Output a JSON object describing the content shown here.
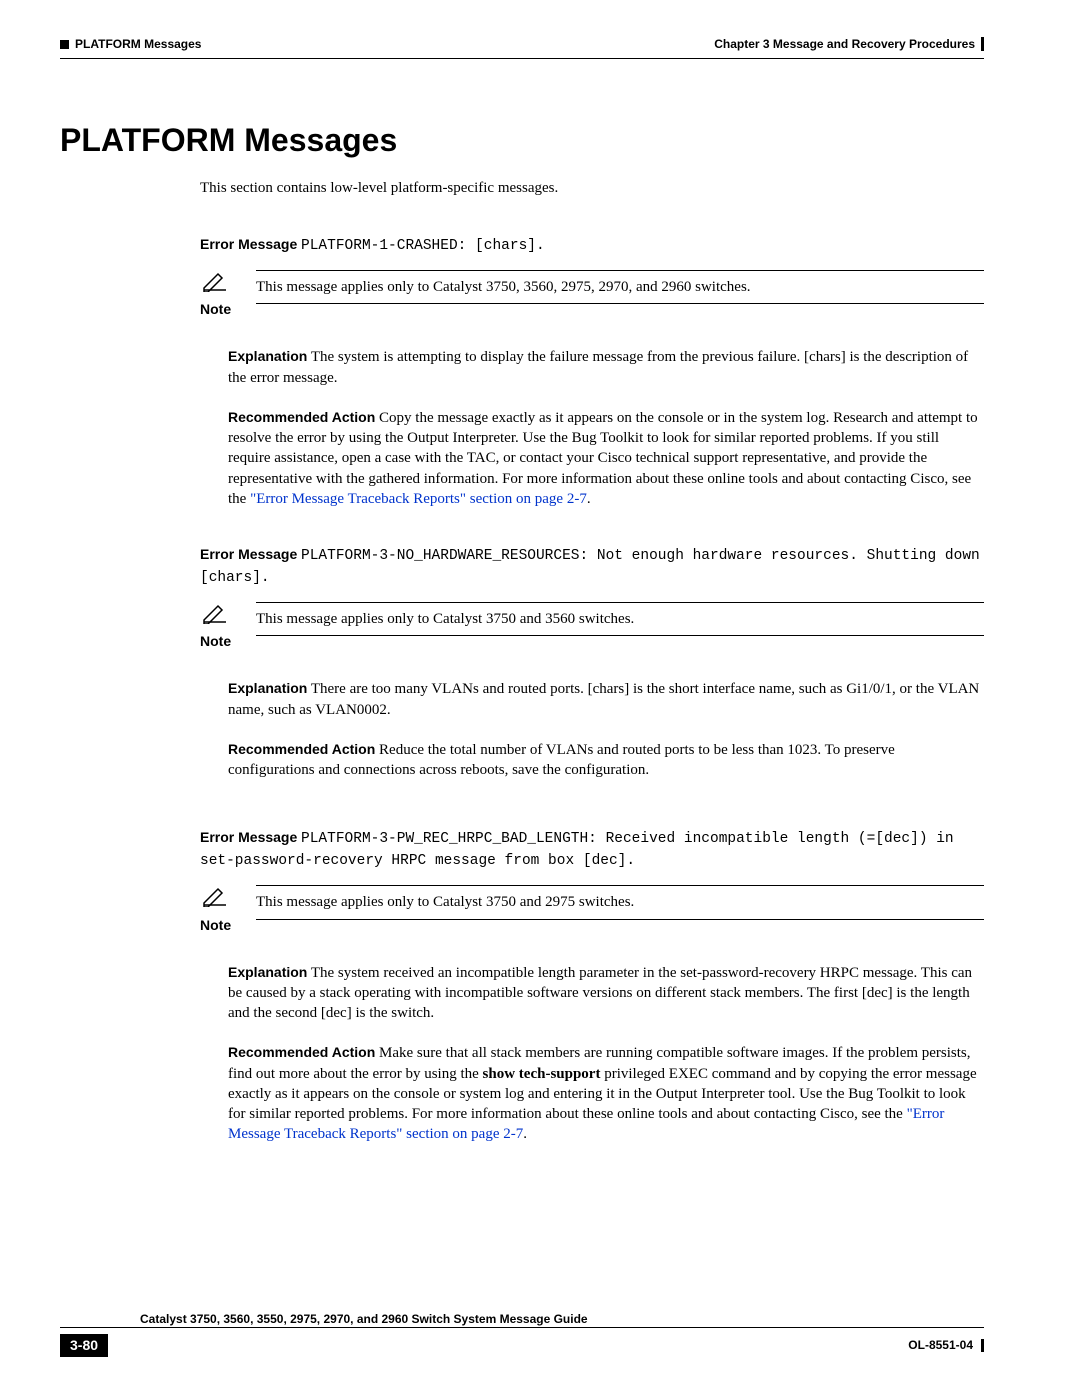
{
  "header": {
    "section": "PLATFORM Messages",
    "chapter": "Chapter 3      Message and Recovery Procedures"
  },
  "title": "PLATFORM Messages",
  "intro": "This section contains low-level platform-specific messages.",
  "labels": {
    "error_message": "Error Message",
    "note": "Note",
    "explanation": "Explanation",
    "recommended_action": "Recommended Action"
  },
  "messages": [
    {
      "code": "PLATFORM-1-CRASHED: [chars].",
      "note": "This message applies only to Catalyst 3750, 3560, 2975, 2970, and 2960 switches.",
      "explanation": "The system is attempting to display the failure message from the previous failure. [chars] is the description of the error message.",
      "action_pre": "Copy the message exactly as it appears on the console or in the system log. Research and attempt to resolve the error by using the Output Interpreter. Use the Bug Toolkit to look for similar reported problems. If you still require assistance, open a case with the TAC, or contact your Cisco technical support representative, and provide the representative with the gathered information. For more information about these online tools and about contacting Cisco, see the ",
      "action_link": "\"Error Message Traceback Reports\" section on page 2-7",
      "action_post": "."
    },
    {
      "code": "PLATFORM-3-NO_HARDWARE_RESOURCES: Not enough hardware resources. Shutting down [chars].",
      "note": "This message applies only to Catalyst 3750 and 3560 switches.",
      "explanation": "There are too many VLANs and routed ports. [chars] is the short interface name, such as Gi1/0/1, or the VLAN name, such as VLAN0002.",
      "action_pre": "Reduce the total number of VLANs and routed ports to be less than 1023. To preserve configurations and connections across reboots, save the configuration.",
      "action_link": "",
      "action_post": ""
    },
    {
      "code": "PLATFORM-3-PW_REC_HRPC_BAD_LENGTH: Received incompatible length (=[dec]) in set-password-recovery HRPC message from box [dec].",
      "note": "This message applies only to Catalyst 3750 and 2975 switches.",
      "explanation": "The system received an incompatible length parameter in the set-password-recovery HRPC message. This can be caused by a stack operating with incompatible software versions on different stack members. The first [dec] is the length and the second [dec] is the switch.",
      "action_pre": "Make sure that all stack members are running compatible software images. If the problem persists, find out more about the error by using the ",
      "action_bold": "show tech-support",
      "action_mid": " privileged EXEC command and by copying the error message exactly as it appears on the console or system log and entering it in the Output Interpreter tool. Use the Bug Toolkit to look for similar reported problems. For more information about these online tools and about contacting Cisco, see the ",
      "action_link": "\"Error Message Traceback Reports\" section on page 2-7",
      "action_post": "."
    }
  ],
  "footer": {
    "guide": "Catalyst 3750, 3560, 3550, 2975, 2970, and 2960 Switch System Message Guide",
    "page": "3-80",
    "docid": "OL-8551-04"
  }
}
